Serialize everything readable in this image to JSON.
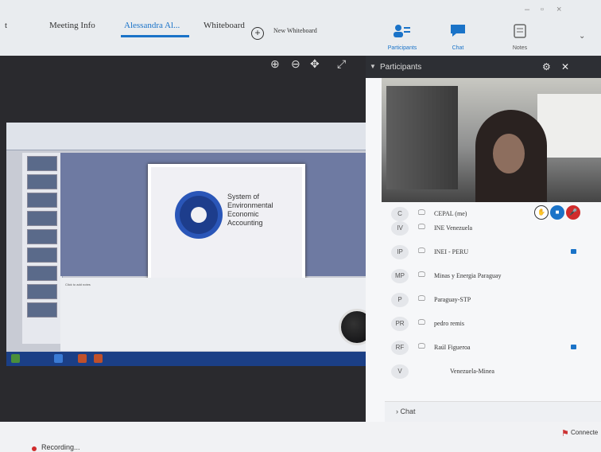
{
  "tabs": [
    "Meeting Info",
    "Alessandra Al...",
    "Whiteboard",
    "New Whiteboard"
  ],
  "tab_partial": "t",
  "toolbar_right": {
    "participants": "Participants",
    "chat": "Chat",
    "notes": "Notes"
  },
  "slide": {
    "lines": [
      "System of",
      "Environmental",
      "Economic",
      "Accounting"
    ]
  },
  "notes_placeholder": "Click to add notes",
  "sidebar": {
    "title": "Participants",
    "participants": [
      {
        "initials": "C",
        "name": "CEPAL (me)",
        "camera": false,
        "controls": true
      },
      {
        "initials": "IV",
        "name": "INE Venezuela",
        "camera": false,
        "controls": false
      },
      {
        "initials": "IP",
        "name": "INEI - PERU",
        "camera": true,
        "controls": false
      },
      {
        "initials": "MP",
        "name": "Minas y Energia Paraguay",
        "camera": false,
        "controls": false
      },
      {
        "initials": "P",
        "name": "Paraguay-STP",
        "camera": false,
        "controls": false
      },
      {
        "initials": "PR",
        "name": "pedro remis",
        "camera": false,
        "controls": false
      },
      {
        "initials": "RF",
        "name": "Raúl Figueroa",
        "camera": true,
        "controls": false
      },
      {
        "initials": "V",
        "name": "Venezuela-Minea",
        "camera": false,
        "controls": false
      }
    ],
    "chat_label": "Chat"
  },
  "status": {
    "recording": "Recording...",
    "connection": "Connecte"
  },
  "colors": {
    "accent": "#1a73c8",
    "recording": "#d02c2c"
  }
}
